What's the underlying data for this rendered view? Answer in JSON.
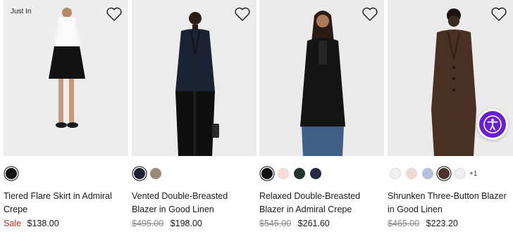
{
  "products": [
    {
      "badge": "Just In",
      "image_alt": "Tiered Flare Skirt in Admiral Crepe",
      "swatches": [
        {
          "color": "#111111",
          "selected": true
        }
      ],
      "more_count": "",
      "title": "Tiered Flare Skirt in Admiral Crepe",
      "sale_label": "Sale",
      "original_price": "",
      "price": "$138.00"
    },
    {
      "badge": "",
      "image_alt": "Vented Double-Breasted Blazer in Good Linen",
      "swatches": [
        {
          "color": "#1c2233",
          "selected": true
        },
        {
          "color": "#9a8a74",
          "selected": false
        }
      ],
      "more_count": "",
      "title": "Vented Double-Breasted Blazer in Good Linen",
      "sale_label": "",
      "original_price": "$495.00",
      "price": "$198.00"
    },
    {
      "badge": "",
      "image_alt": "Relaxed Double-Breasted Blazer in Admiral Crepe",
      "swatches": [
        {
          "color": "#111111",
          "selected": true
        },
        {
          "color": "#f7ddd6",
          "selected": false
        },
        {
          "color": "#24332c",
          "selected": false
        },
        {
          "color": "#242a42",
          "selected": false
        }
      ],
      "more_count": "",
      "title": "Relaxed Double-Breasted Blazer in Admiral Crepe",
      "sale_label": "",
      "original_price": "$545.00",
      "price": "$261.60"
    },
    {
      "badge": "",
      "image_alt": "Shrunken Three-Button Blazer in Good Linen",
      "swatches": [
        {
          "color": "#f1f0ec",
          "selected": false
        },
        {
          "color": "#f3d9d3",
          "selected": false
        },
        {
          "color": "#b8bfd9",
          "selected": false
        },
        {
          "color": "#4d3327",
          "selected": true
        },
        {
          "color": "#efefed",
          "selected": false
        }
      ],
      "more_count": "+1",
      "title": "Shrunken Three-Button Blazer in Good Linen",
      "sale_label": "",
      "original_price": "$465.00",
      "price": "$223.20"
    }
  ],
  "colors": {
    "sale_red": "#c4302b",
    "strike_gray": "#8a8a8a",
    "accessibility_purple": "#6a1fd0"
  },
  "icons": {
    "wishlist": "heart-outline-icon",
    "accessibility": "accessibility-person-icon"
  }
}
